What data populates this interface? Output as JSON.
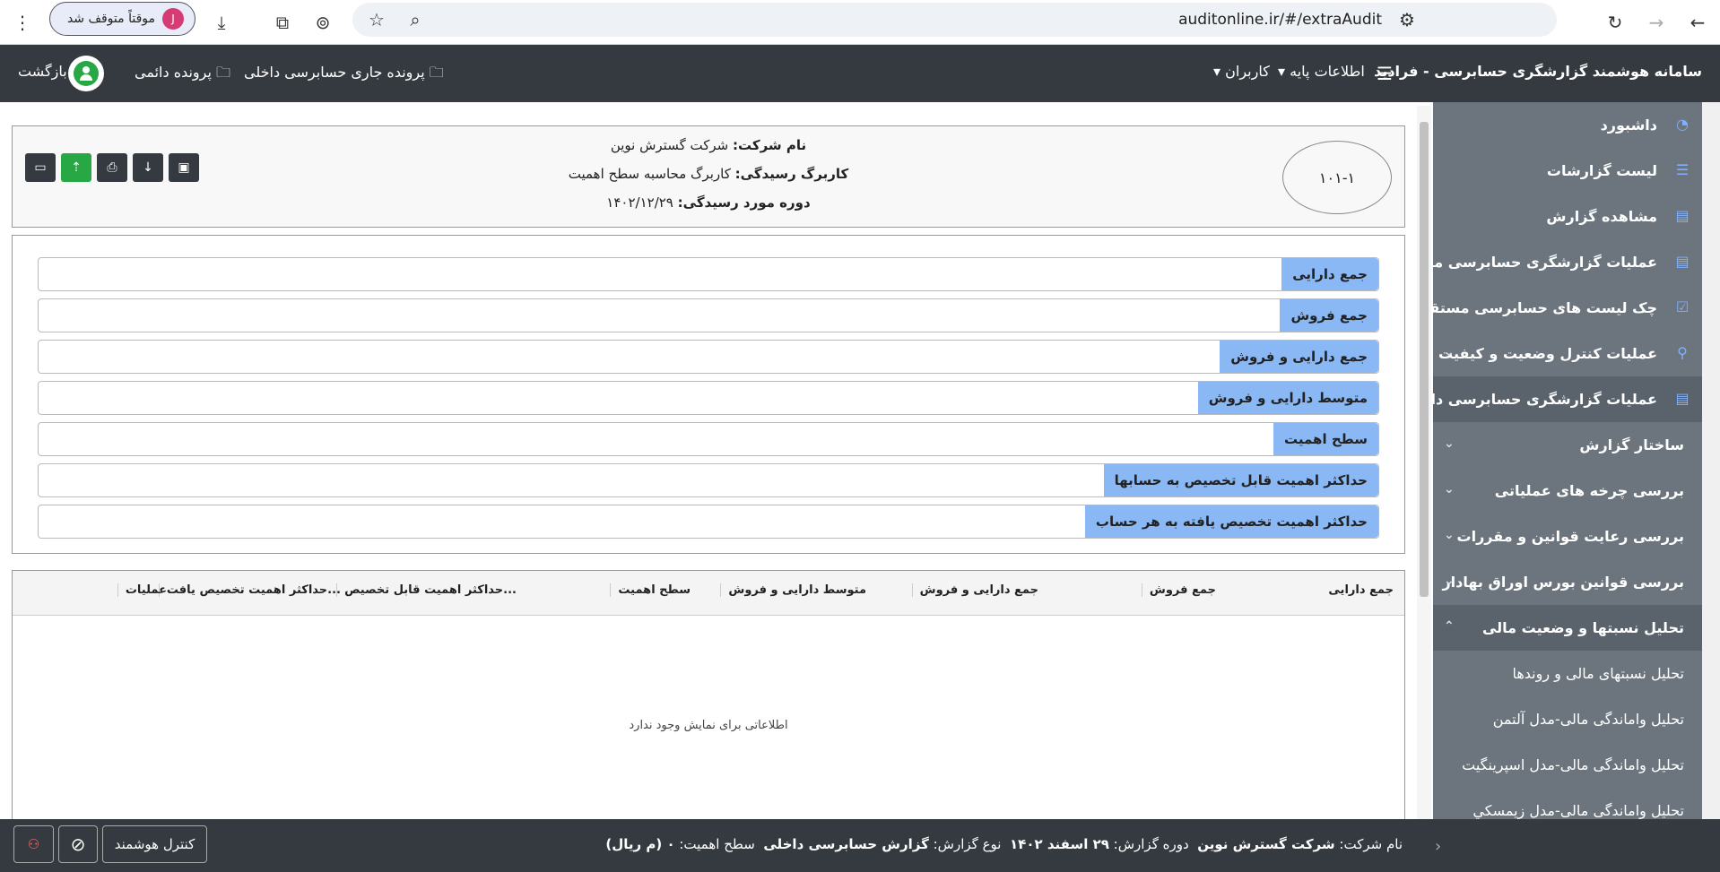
{
  "browser": {
    "url": "auditonline.ir/#/extraAudit",
    "profile_label": "موقتاً متوقف شد",
    "profile_initial": "J"
  },
  "topnav": {
    "app_title": "سامانه هوشمند گزارشگری حسابرسی - فرادید",
    "base_info": "اطلاعات پایه",
    "users": "کاربران",
    "current_file": "پرونده جاری حسابرسی داخلی",
    "permanent_file": "پرونده دائمی",
    "back": "بازگشت"
  },
  "sidebar": {
    "items": [
      {
        "label": "داشبورد",
        "icon": "gauge-icon"
      },
      {
        "label": "لیست گزارشات",
        "icon": "list-icon"
      },
      {
        "label": "مشاهده گزارش",
        "icon": "report-icon"
      },
      {
        "label": "عملیات گزارشگری حسابرسی مستقل",
        "icon": "document-icon"
      },
      {
        "label": "چک لیست های حسابرسی مستقل",
        "icon": "checklist-icon"
      },
      {
        "label": "عملیات کنترل وضعیت و کیفیت",
        "icon": "search-icon"
      },
      {
        "label": "عملیات گزارشگری حسابرسی داخلی",
        "icon": "document-icon"
      }
    ],
    "groups": [
      "ساختار گزارش",
      "بررسی چرخه های عملیاتی",
      "بررسی رعایت قوانین و مقررات",
      "بررسی قوانین بورس اوراق بهادار",
      "تحلیل نسبتها و وضعیت مالی"
    ],
    "subitems": [
      "تحلیل نسبتهای مالی و روندها",
      "تحلیل واماندگی مالی-مدل آلتمن",
      "تحلیل واماندگی مالی-مدل اسپرینگیت",
      "تحلیل واماندگی مالی-مدل زیمسکي"
    ]
  },
  "header_card": {
    "code": "۱۰۱-۱",
    "company_label": "نام شرکت:",
    "company_value": "شرکت گسترش نوین",
    "sheet_label": "کاربرگ رسیدگی:",
    "sheet_value": "کاربرگ محاسبه سطح اهمیت",
    "period_label": "دوره مورد رسیدگی:",
    "period_value": "۱۴۰۲/۱۲/۲۹"
  },
  "form": {
    "fields": [
      "جمع دارایی",
      "جمع فروش",
      "جمع دارایی و فروش",
      "متوسط دارایی و فروش",
      "سطح اهمیت",
      "حداکثر اهمیت قابل تخصیص به حسابها",
      "حداکثر اهمیت تخصیص یافته به هر حساب"
    ]
  },
  "table": {
    "columns": [
      "جمع دارایی",
      "جمع فروش",
      "جمع دارایی و فروش",
      "متوسط دارایی و فروش",
      "سطح اهمیت",
      "حداکثر اهمیت قابل تخصیص...",
      "حداکثر اهمیت تخصیص یافت...",
      "عملیات"
    ],
    "empty_message": "اطلاعاتی برای نمایش وجود ندارد"
  },
  "footer": {
    "company_label": "نام شرکت:",
    "company_value": "شرکت گسترش نوین",
    "period_label": "دوره گزارش:",
    "period_value": "۲۹ اسفند ۱۴۰۲",
    "type_label": "نوع گزارش:",
    "type_value": "گزارش حسابرسی داخلی",
    "level_label": "سطح اهمیت:",
    "level_value": "۰ (م ریال)",
    "smart_control": "کنترل هوشمند"
  }
}
